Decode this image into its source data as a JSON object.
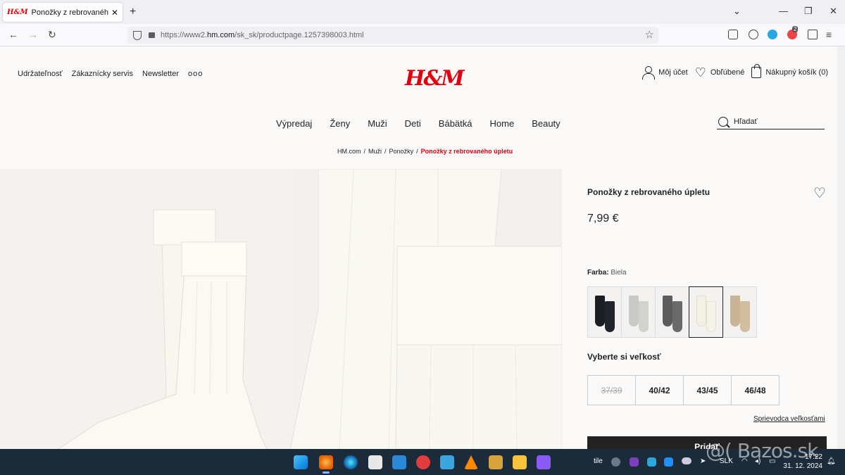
{
  "browser": {
    "tab_title": "Ponožky z rebrovaného úpletu",
    "tab_favicon_text": "H&M",
    "url_prefix": "https://www2.",
    "url_domain": "hm.com",
    "url_path": "/sk_sk/productpage.1257398003.html",
    "extension_badge": "2"
  },
  "header": {
    "links": [
      "Udržateľnosť",
      "Zákaznícky servis",
      "Newsletter"
    ],
    "more": "ooo",
    "logo": "H&M",
    "account": "Môj účet",
    "favorites": "Obľúbené",
    "cart": "Nákupný košík (0)"
  },
  "nav": {
    "items": [
      "Výpredaj",
      "Ženy",
      "Muži",
      "Deti",
      "Bábätká",
      "Home",
      "Beauty"
    ],
    "search_placeholder": "Hľadať"
  },
  "breadcrumb": {
    "items": [
      "HM.com",
      "Muži",
      "Ponožky"
    ],
    "current": "Ponožky z rebrovaného úpletu"
  },
  "product": {
    "name": "Ponožky z rebrovaného úpletu",
    "price": "7,99 €",
    "color_label": "Farba:",
    "color_value": "Biela",
    "swatches": [
      {
        "color": "#1b1d24",
        "selected": false
      },
      {
        "color": "#c9c9c7",
        "selected": false
      },
      {
        "color": "#5c5c5c",
        "selected": false
      },
      {
        "color": "#f3f0e4",
        "selected": true
      },
      {
        "color": "#cbb495",
        "selected": false
      }
    ],
    "size_title": "Vyberte si veľkosť",
    "sizes": [
      {
        "label": "37/39",
        "available": false
      },
      {
        "label": "40/42",
        "available": true
      },
      {
        "label": "43/45",
        "available": true
      },
      {
        "label": "46/48",
        "available": true
      }
    ],
    "size_guide": "Sprievodca veľkosťami",
    "add_button": "Pridať"
  },
  "taskbar": {
    "weather": "tile",
    "language": "SLK",
    "time": "17:22",
    "date": "31. 12. 2024",
    "watermark": "@( Bazos.sk"
  }
}
